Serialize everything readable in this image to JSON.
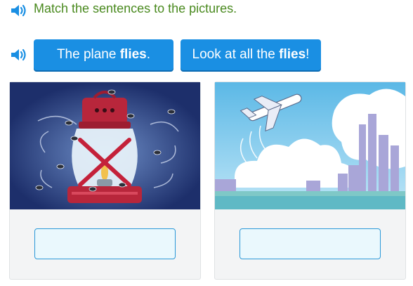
{
  "instruction": "Match the sentences to the pictures.",
  "tiles": [
    {
      "before": "The plane ",
      "bold": "flies",
      "after": "."
    },
    {
      "before": "Look at all the ",
      "bold": "flies",
      "after": "!"
    }
  ],
  "icons": {
    "audio": "speaker-icon"
  },
  "colors": {
    "instruction": "#4a8a1f",
    "tile": "#1a8fe3",
    "dropzone_border": "#2a98d8",
    "dropzone_fill": "#eaf8fd"
  },
  "dropzones": [
    {
      "value": ""
    },
    {
      "value": ""
    }
  ]
}
